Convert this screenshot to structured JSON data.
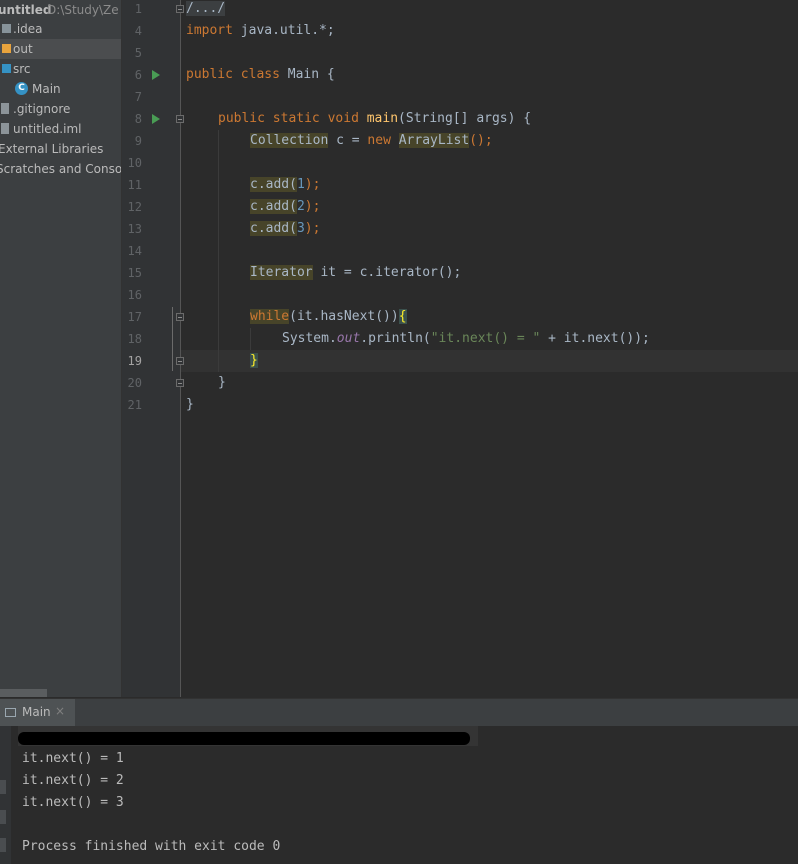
{
  "project": {
    "root_name": "untitled",
    "root_path": "D:\\Study\\Ze",
    "items": [
      {
        "label": ".idea",
        "kind": "folder",
        "color": "#87939a"
      },
      {
        "label": "out",
        "kind": "folder",
        "color": "#e8a33d",
        "selected": true
      },
      {
        "label": "src",
        "kind": "folder",
        "color": "#3592c4"
      },
      {
        "label": "Main",
        "kind": "java-class",
        "color": "#3592c4"
      },
      {
        "label": ".gitignore",
        "kind": "file",
        "color": "#a9b7c6"
      },
      {
        "label": "untitled.iml",
        "kind": "file",
        "color": "#a9b7c6"
      },
      {
        "label": "External Libraries",
        "kind": "library"
      },
      {
        "label": "Scratches and Consoles",
        "kind": "scratches"
      }
    ]
  },
  "editor": {
    "line_numbers": [
      "1",
      "4",
      "5",
      "6",
      "7",
      "8",
      "9",
      "10",
      "11",
      "12",
      "13",
      "14",
      "15",
      "16",
      "17",
      "18",
      "19",
      "20",
      "21"
    ],
    "current_line": "19",
    "code": {
      "fold": "/.../",
      "import_kw": "import",
      "import_rest": " java.util.*;",
      "cls_public": "public",
      "cls_class": "class",
      "cls_rest": " Main {",
      "main_public": "public",
      "main_static": "static",
      "main_void": "void",
      "main_name": "main",
      "main_rest": "(String[] args) {",
      "collection_type": "Collection",
      "collection_mid": " c = ",
      "new_kw": "new",
      "arraylist_type": "ArrayList",
      "collection_end": "();",
      "add_obj": "c",
      "add_method": ".add(",
      "add_args": [
        "1",
        "2",
        "3"
      ],
      "add_close": ");",
      "iterator_type": "Iterator",
      "iterator_rest": " it = c.iterator();",
      "while_kw": "while",
      "while_rest": "(it.hasNext())",
      "brace_open": "{",
      "println_pre": "System.",
      "println_out": "out",
      "println_method": ".println(",
      "println_str": "\"it.next() = \"",
      "println_post": " + it.next());",
      "brace_close": "}",
      "method_close": "}",
      "class_close": "}"
    }
  },
  "run_panel": {
    "tab_label": "Main",
    "close_glyph": "×",
    "output": [
      "it.next() = 1",
      "it.next() = 2",
      "it.next() = 3",
      "",
      "Process finished with exit code 0"
    ]
  }
}
